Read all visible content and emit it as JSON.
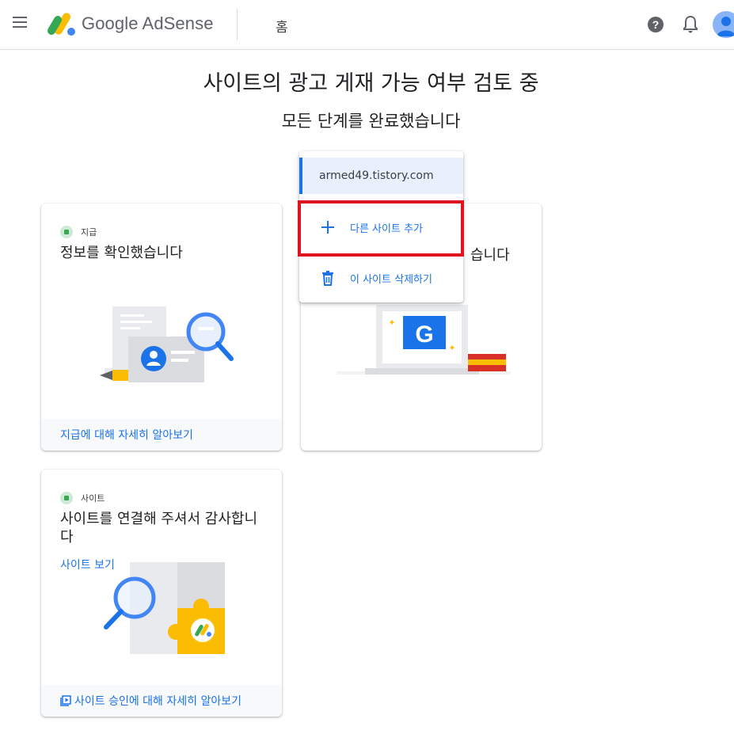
{
  "header": {
    "brand": "Google AdSense",
    "page": "홈",
    "icons": {
      "menu": "menu-icon",
      "help": "help-icon",
      "notifications": "bell-icon",
      "account": "avatar"
    }
  },
  "main": {
    "title": "사이트의 광고 게재 가능 여부 검토 중",
    "subtitle": "모든 단계를 완료했습니다"
  },
  "cards": [
    {
      "tag": "지급",
      "title": "정보를 확인했습니다",
      "footer_link": "지급에 대해 자세히 알아보기"
    },
    {
      "title_visible_tail": "습니다"
    },
    {
      "tag": "사이트",
      "title": "사이트를 연결해 주셔서 감사합니다",
      "link": "사이트 보기",
      "footer_link": "사이트 승인에 대해 자세히 알아보기"
    }
  ],
  "site_menu": {
    "current_site": "armed49.tistory.com",
    "add_site": "다른 사이트 추가",
    "delete_site": "이 사이트 삭제하기"
  },
  "colors": {
    "accent": "#1a73e8",
    "highlight": "#e0141e",
    "success": "#34a853"
  }
}
